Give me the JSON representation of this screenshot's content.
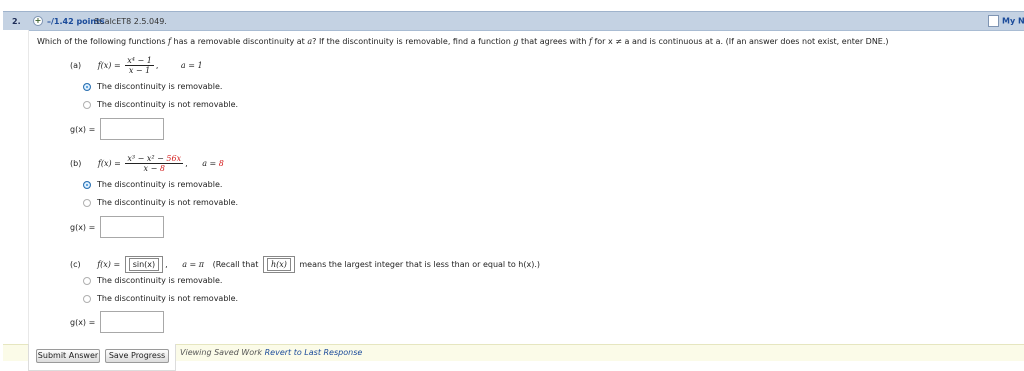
{
  "header": {
    "number": "2.",
    "points": "–/1.42 points",
    "course": "SCalcET8 2.5.049.",
    "my_notes": "My Notes"
  },
  "prompt": {
    "text_1": "Which of the following functions ",
    "f": "f",
    "text_2": " has a removable discontinuity at ",
    "a": "a",
    "text_3": "? If the discontinuity is removable, find a function ",
    "g": "g",
    "text_4": " that agrees with ",
    "text_5": " for x ≠ a and is continuous at a. (If an answer does not exist, enter DNE.)"
  },
  "parts": {
    "a": {
      "label": "(a)",
      "fx": "f(x) =",
      "num": "x⁴ − 1",
      "den": "x − 1",
      "a_eq": "a = 1",
      "opt_removable": "The discontinuity is removable.",
      "opt_not_removable": "The discontinuity is not removable.",
      "selected": "removable",
      "g_label": "g(x) =",
      "g_value": ""
    },
    "b": {
      "label": "(b)",
      "fx": "f(x) =",
      "num": "x³ − x² − ",
      "num_red": "56x",
      "den_prefix": "x − ",
      "den_red": "8",
      "a_prefix": "a = ",
      "a_red": "8",
      "opt_removable": "The discontinuity is removable.",
      "opt_not_removable": "The discontinuity is not removable.",
      "selected": "removable",
      "g_label": "g(x) =",
      "g_value": ""
    },
    "c": {
      "label": "(c)",
      "fx": "f(x) =",
      "inner": "sin(x)",
      "a_eq": "a = π",
      "recall_1": "(Recall that",
      "hx": "h(x)",
      "recall_2": "means the largest integer that is less than or equal to h(x).)",
      "opt_removable": "The discontinuity is removable.",
      "opt_not_removable": "The discontinuity is not removable.",
      "selected": "none",
      "g_label": "g(x) =",
      "g_value": ""
    }
  },
  "footer": {
    "submit": "Submit Answer",
    "save": "Save Progress",
    "viewing": "Viewing Saved Work",
    "revert": "Revert to Last Response"
  },
  "colors": {
    "header_bg": "#c4d2e3",
    "accent_red": "#d42020",
    "link_blue": "#1b4b9a",
    "radio_selected": "#3a8fd6",
    "footer_bg": "#fbfbe8"
  }
}
